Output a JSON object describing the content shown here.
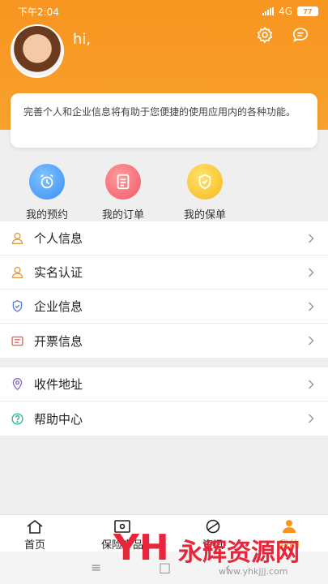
{
  "status_bar": {
    "time": "下午2:04",
    "network": "4G",
    "battery": "77"
  },
  "profile": {
    "greeting": "hi,"
  },
  "info_card": {
    "text": "完善个人和企业信息将有助于您便捷的使用应用内的各种功能。"
  },
  "shortcuts": [
    {
      "label": "我的预约",
      "icon": "alarm-clock-icon",
      "color": "#3a8df5"
    },
    {
      "label": "我的订单",
      "icon": "order-icon",
      "color": "#f05a6a"
    },
    {
      "label": "我的保单",
      "icon": "policy-icon",
      "color": "#f6b81d"
    }
  ],
  "menu_group_1": [
    {
      "label": "个人信息",
      "icon": "person-icon"
    },
    {
      "label": "实名认证",
      "icon": "id-verify-icon"
    },
    {
      "label": "企业信息",
      "icon": "shield-icon"
    },
    {
      "label": "开票信息",
      "icon": "invoice-icon"
    }
  ],
  "menu_group_2": [
    {
      "label": "收件地址",
      "icon": "location-icon"
    },
    {
      "label": "帮助中心",
      "icon": "help-icon"
    }
  ],
  "tabbar": [
    {
      "label": "首页",
      "icon": "home-icon"
    },
    {
      "label": "保险产品",
      "icon": "product-icon"
    },
    {
      "label": "资讯",
      "icon": "news-icon"
    },
    {
      "label": "我的",
      "icon": "profile-icon",
      "active": true
    }
  ],
  "watermark": {
    "logo": "YH",
    "name": "永辉资源网",
    "url": "www.yhkjjj.com"
  },
  "colors": {
    "accent": "#f7951f",
    "background": "#efefef"
  }
}
